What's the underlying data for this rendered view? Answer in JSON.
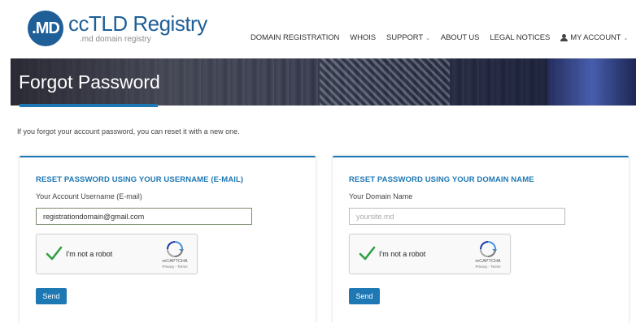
{
  "logo": {
    "badge": ".MD",
    "title": "ccTLD Registry",
    "subtitle": ".md domain registry"
  },
  "nav": {
    "items": [
      {
        "label": "DOMAIN REGISTRATION"
      },
      {
        "label": "WHOIS"
      },
      {
        "label": "SUPPORT"
      },
      {
        "label": "ABOUT US"
      },
      {
        "label": "LEGAL NOTICES"
      },
      {
        "label": "MY ACCOUNT"
      }
    ]
  },
  "banner": {
    "title": "Forgot Password"
  },
  "intro": "If you forgot your account password, you can reset it with a new one.",
  "panels": {
    "username": {
      "title": "RESET PASSWORD USING YOUR USERNAME (E-MAIL)",
      "label": "Your Account Username (E-mail)",
      "value": "registrationdomain@gmail.com",
      "placeholder": "",
      "send": "Send"
    },
    "domain": {
      "title": "RESET PASSWORD USING YOUR DOMAIN NAME",
      "label": "Your Domain Name",
      "value": "",
      "placeholder": "yoursite.md",
      "send": "Send"
    }
  },
  "captcha": {
    "label": "I'm not a robot",
    "brand": "reCAPTCHA",
    "terms": "Privacy - Terms",
    "checked": true
  },
  "colors": {
    "brand": "#1f5f98",
    "accent": "#1e78b4",
    "check": "#2ea043"
  }
}
